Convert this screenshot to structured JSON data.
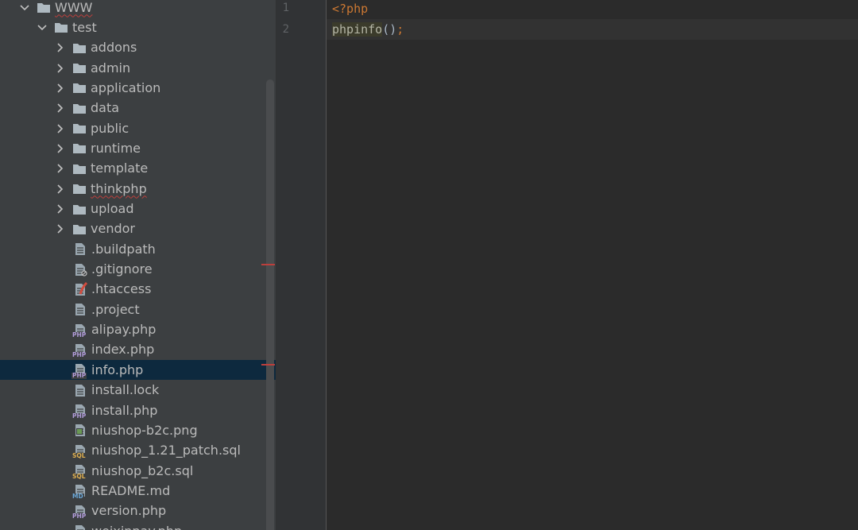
{
  "project_tree": {
    "items": [
      {
        "label": "WWW",
        "kind": "folder",
        "expanded": true,
        "squiggle": true
      },
      {
        "label": "test",
        "kind": "folder",
        "expanded": true,
        "squiggle": false
      },
      {
        "label": "addons",
        "kind": "folder",
        "expanded": false
      },
      {
        "label": "admin",
        "kind": "folder",
        "expanded": false
      },
      {
        "label": "application",
        "kind": "folder",
        "expanded": false
      },
      {
        "label": "data",
        "kind": "folder",
        "expanded": false
      },
      {
        "label": "public",
        "kind": "folder",
        "expanded": false
      },
      {
        "label": "runtime",
        "kind": "folder",
        "expanded": false
      },
      {
        "label": "template",
        "kind": "folder",
        "expanded": false
      },
      {
        "label": "thinkphp",
        "kind": "folder",
        "expanded": false,
        "squiggle": true
      },
      {
        "label": "upload",
        "kind": "folder",
        "expanded": false
      },
      {
        "label": "vendor",
        "kind": "folder",
        "expanded": false
      },
      {
        "label": ".buildpath",
        "kind": "text-file"
      },
      {
        "label": ".gitignore",
        "kind": "ignore-file"
      },
      {
        "label": ".htaccess",
        "kind": "htaccess-file"
      },
      {
        "label": ".project",
        "kind": "text-file"
      },
      {
        "label": "alipay.php",
        "kind": "php-file",
        "badge": "PHP"
      },
      {
        "label": "index.php",
        "kind": "php-file",
        "badge": "PHP"
      },
      {
        "label": "info.php",
        "kind": "php-file",
        "badge": "PHP",
        "selected": true
      },
      {
        "label": "install.lock",
        "kind": "text-file"
      },
      {
        "label": "install.php",
        "kind": "php-file",
        "badge": "PHP"
      },
      {
        "label": "niushop-b2c.png",
        "kind": "image-file"
      },
      {
        "label": "niushop_1.21_patch.sql",
        "kind": "sql-file",
        "badge": "SQL"
      },
      {
        "label": "niushop_b2c.sql",
        "kind": "sql-file",
        "badge": "SQL"
      },
      {
        "label": "README.md",
        "kind": "md-file",
        "badge": "MD"
      },
      {
        "label": "version.php",
        "kind": "php-file",
        "badge": "PHP"
      },
      {
        "label": "weixinpay.php",
        "kind": "php-file",
        "badge": "PHP"
      }
    ]
  },
  "editor": {
    "line_numbers": [
      "1",
      "2"
    ],
    "lines": [
      {
        "tokens": [
          {
            "text": "<?php",
            "type": "tag"
          }
        ]
      },
      {
        "tokens": [
          {
            "text": "phpinfo",
            "type": "fn"
          },
          {
            "text": "()",
            "type": "paren"
          },
          {
            "text": ";",
            "type": "semi"
          }
        ]
      }
    ]
  },
  "colors": {
    "tree_background": "#3c3f41",
    "editor_background": "#2b2b2b",
    "selection": "#0d293e",
    "keyword_orange": "#cc7832",
    "error_red": "#bc3f3c"
  }
}
